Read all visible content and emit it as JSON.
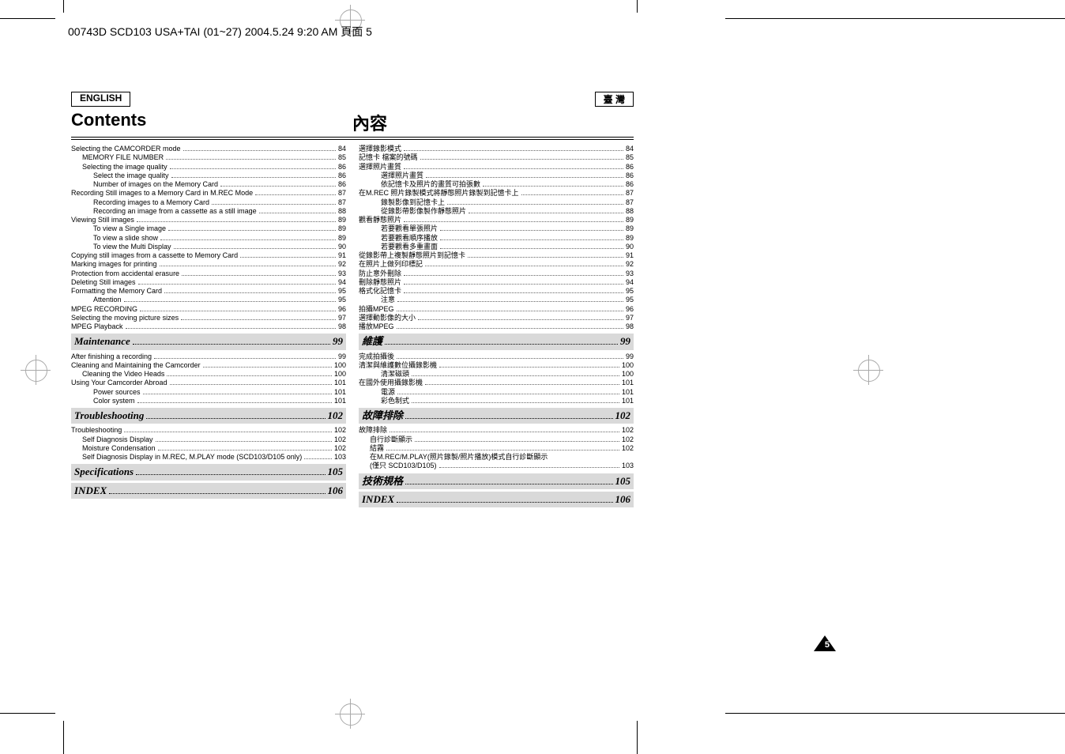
{
  "header": {
    "filename": "00743D SCD103 USA+TAI (01~27) 2004.5.24 9:20 AM 頁面 5"
  },
  "badges": {
    "left": "ENGLISH",
    "right": "臺 灣"
  },
  "titles": {
    "left": "Contents",
    "right": "內容"
  },
  "left_toc": [
    {
      "label": "Selecting the CAMCORDER mode",
      "page": "84",
      "indent": 0
    },
    {
      "label": "MEMORY FILE NUMBER",
      "page": "85",
      "indent": 1
    },
    {
      "label": "Selecting the image quality",
      "page": "86",
      "indent": 1
    },
    {
      "label": "Select the image quality",
      "page": "86",
      "indent": 2
    },
    {
      "label": "Number of images on the Memory Card",
      "page": "86",
      "indent": 2
    },
    {
      "label": "Recording Still images to a Memory Card in M.REC Mode",
      "page": "87",
      "indent": 0
    },
    {
      "label": "Recording images to a Memory Card",
      "page": "87",
      "indent": 2
    },
    {
      "label": "Recording an image from a cassette as a still image",
      "page": "88",
      "indent": 2
    },
    {
      "label": "Viewing Still images",
      "page": "89",
      "indent": 0
    },
    {
      "label": "To view a Single image",
      "page": "89",
      "indent": 2
    },
    {
      "label": "To view a slide show",
      "page": "89",
      "indent": 2
    },
    {
      "label": "To view the Multi Display",
      "page": "90",
      "indent": 2
    },
    {
      "label": "Copying still images from a cassette to Memory Card",
      "page": "91",
      "indent": 0
    },
    {
      "label": "Marking images for printing",
      "page": "92",
      "indent": 0
    },
    {
      "label": "Protection from accidental erasure",
      "page": "93",
      "indent": 0
    },
    {
      "label": "Deleting Still images",
      "page": "94",
      "indent": 0
    },
    {
      "label": "Formatting the Memory Card",
      "page": "95",
      "indent": 0
    },
    {
      "label": "Attention",
      "page": "95",
      "indent": 2
    },
    {
      "label": "MPEG RECORDING",
      "page": "96",
      "indent": 0
    },
    {
      "label": "Selecting the moving picture sizes",
      "page": "97",
      "indent": 0
    },
    {
      "label": "MPEG Playback",
      "page": "98",
      "indent": 0
    }
  ],
  "left_section_maint": {
    "label": "Maintenance",
    "page": "99"
  },
  "left_maint": [
    {
      "label": "After finishing a recording",
      "page": "99",
      "indent": 0
    },
    {
      "label": "Cleaning and Maintaining the Camcorder",
      "page": "100",
      "indent": 0
    },
    {
      "label": "Cleaning the Video Heads",
      "page": "100",
      "indent": 1
    },
    {
      "label": "Using Your Camcorder Abroad",
      "page": "101",
      "indent": 0
    },
    {
      "label": "Power sources",
      "page": "101",
      "indent": 2
    },
    {
      "label": "Color system",
      "page": "101",
      "indent": 2
    }
  ],
  "left_section_trouble": {
    "label": "Troubleshooting",
    "page": "102"
  },
  "left_trouble": [
    {
      "label": "Troubleshooting",
      "page": "102",
      "indent": 0
    },
    {
      "label": "Self Diagnosis Display",
      "page": "102",
      "indent": 1
    },
    {
      "label": "Moisture Condensation",
      "page": "102",
      "indent": 1
    },
    {
      "label": "Self Diagnosis Display in M.REC, M.PLAY mode (SCD103/D105 only)",
      "page": "103",
      "indent": 1
    }
  ],
  "left_section_spec": {
    "label": "Specifications",
    "page": "105"
  },
  "left_section_index": {
    "label": "INDEX",
    "page": "106"
  },
  "right_toc": [
    {
      "label": "選擇錄影模式",
      "page": "84",
      "indent": 0
    },
    {
      "label": "記憶卡 檔案的號碼",
      "page": "85",
      "indent": 0
    },
    {
      "label": "選擇照片畫質",
      "page": "86",
      "indent": 0
    },
    {
      "label": "選擇照片畫質",
      "page": "86",
      "indent": 2
    },
    {
      "label": "依記憶卡及照片的畫質可拍張數",
      "page": "86",
      "indent": 2
    },
    {
      "label": "在M.REC 照片錄製模式將靜態照片錄製到記憶卡上",
      "page": "87",
      "indent": 0
    },
    {
      "label": "錄製影像到記憶卡上",
      "page": "87",
      "indent": 2
    },
    {
      "label": "從錄影帶影像製作靜態照片",
      "page": "88",
      "indent": 2
    },
    {
      "label": "觀看靜態照片",
      "page": "89",
      "indent": 0
    },
    {
      "label": "若要觀看單張照片",
      "page": "89",
      "indent": 2
    },
    {
      "label": "若要觀看順序播放",
      "page": "89",
      "indent": 2
    },
    {
      "label": "若要觀看多重畫面",
      "page": "90",
      "indent": 2
    },
    {
      "label": "從錄影帶上複製靜態照片到記憶卡",
      "page": "91",
      "indent": 0
    },
    {
      "label": "在照片上做列印標記",
      "page": "92",
      "indent": 0
    },
    {
      "label": "防止意外刪除",
      "page": "93",
      "indent": 0
    },
    {
      "label": "刪除靜態照片",
      "page": "94",
      "indent": 0
    },
    {
      "label": "格式化記憶卡",
      "page": "95",
      "indent": 0
    },
    {
      "label": "注意",
      "page": "95",
      "indent": 2
    },
    {
      "label": "拍攝MPEG",
      "page": "96",
      "indent": 0
    },
    {
      "label": "選擇動影像的大小",
      "page": "97",
      "indent": 0
    },
    {
      "label": "播放MPEG",
      "page": "98",
      "indent": 0
    }
  ],
  "right_section_maint": {
    "label": "維護",
    "page": "99"
  },
  "right_maint": [
    {
      "label": "完成拍攝後",
      "page": "99",
      "indent": 0
    },
    {
      "label": "清潔與維護數位攝錄影機",
      "page": "100",
      "indent": 0
    },
    {
      "label": "清潔磁頭",
      "page": "100",
      "indent": 2
    },
    {
      "label": "在國外使用攝錄影機",
      "page": "101",
      "indent": 0
    },
    {
      "label": "電源",
      "page": "101",
      "indent": 2
    },
    {
      "label": "彩色制式",
      "page": "101",
      "indent": 2
    }
  ],
  "right_section_trouble": {
    "label": "故障排除",
    "page": "102"
  },
  "right_trouble": [
    {
      "label": "故障排除",
      "page": "102",
      "indent": 0
    },
    {
      "label": "自行診斷顯示",
      "page": "102",
      "indent": 1
    },
    {
      "label": "結霧",
      "page": "102",
      "indent": 1
    },
    {
      "label": "在M.REC/M.PLAY(照片錄製/照片播放)模式自行診斷顯示",
      "page": "",
      "indent": 1,
      "nodots": true
    },
    {
      "label": "(僅只 SCD103/D105)",
      "page": "103",
      "indent": 1
    }
  ],
  "right_section_spec": {
    "label": "技術規格",
    "page": "105"
  },
  "right_section_index": {
    "label": "INDEX",
    "page": "106"
  },
  "page_number": "5"
}
